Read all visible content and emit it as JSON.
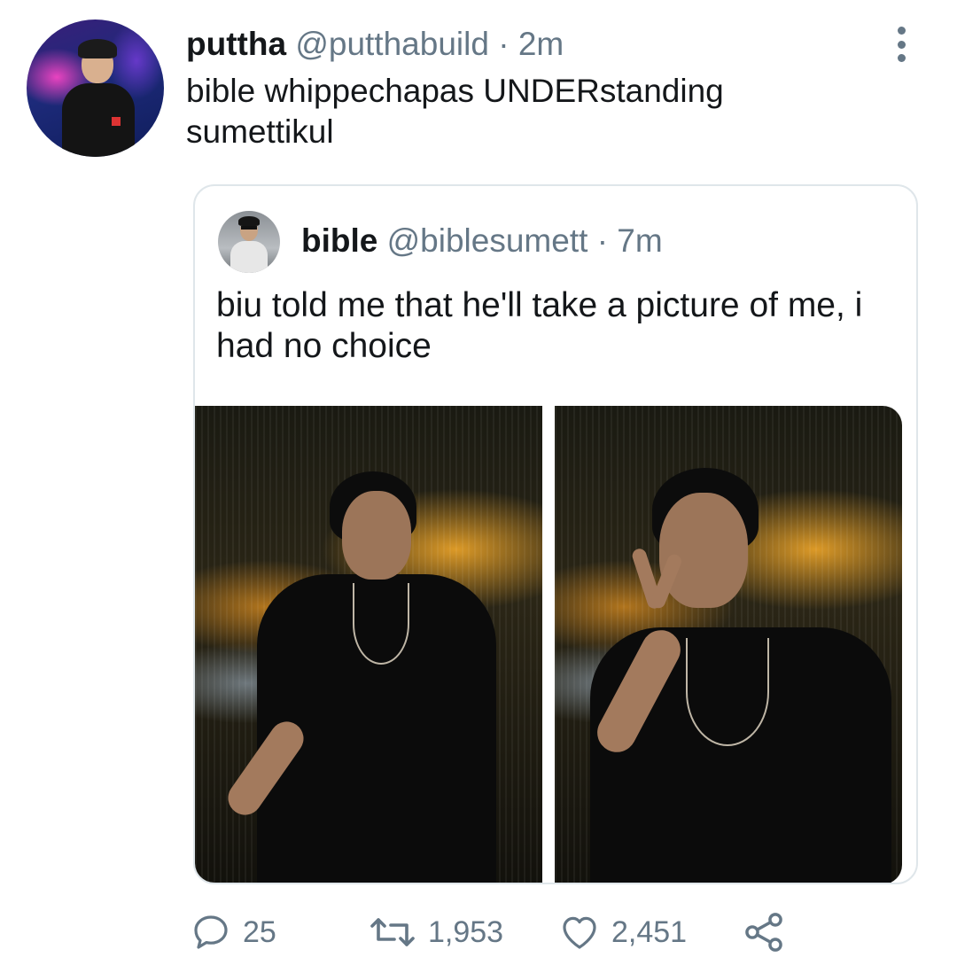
{
  "tweet": {
    "author_name": "puttha",
    "author_handle": "@putthabuild",
    "separator": "·",
    "time": "2m",
    "text": "bible whippechapas UNDERstanding sumettikul"
  },
  "quoted_tweet": {
    "author_name": "bible",
    "author_handle": "@biblesumett",
    "separator": "·",
    "time": "7m",
    "text": "biu told me that he'll take a picture of me, i had no choice"
  },
  "actions": {
    "replies": "25",
    "retweets": "1,953",
    "likes": "2,451"
  },
  "icons": {
    "reply": "reply-icon",
    "retweet": "retweet-icon",
    "like": "heart-icon",
    "share": "share-icon",
    "more": "more-options-icon"
  },
  "colors": {
    "text": "#14171a",
    "secondary": "#657786",
    "border": "#dfe6ea"
  }
}
